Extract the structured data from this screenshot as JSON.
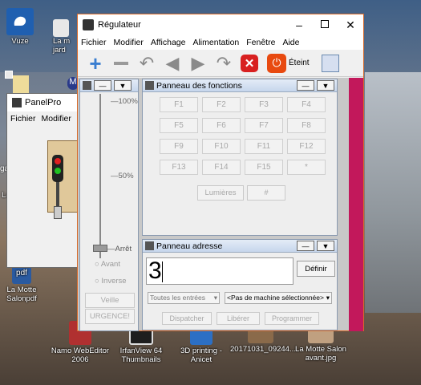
{
  "desktop": {
    "icons": {
      "vuze": "Vuze",
      "la_ma_jard": "La m\njard",
      "la_motte_salon_pdf": "La Motte\nSalonpdf",
      "namo": "Namo WebEditor\n2006",
      "irfanview": "IrfanView 64\nThumbnails",
      "printing": "3D printing -\nAnicet",
      "photo": "20171031_09244...",
      "la_motte_avant": "La Motte Salon\navant.jpg",
      "la": "La",
      "side_ga": "ga",
      "side_m": "M",
      "pdf_badge": "pdf"
    }
  },
  "panelpro": {
    "title": "PanelPro",
    "menu": [
      "Fichier",
      "Modifier"
    ]
  },
  "regulateur": {
    "title": "Régulateur",
    "menu": [
      "Fichier",
      "Modifier",
      "Affichage",
      "Alimentation",
      "Fenêtre",
      "Aide"
    ],
    "toolbar": {
      "power_label": "Éteint"
    },
    "throttle": {
      "title": "",
      "percent_100": "100%",
      "percent_50": "50%",
      "arret": "Arrêt",
      "avant": "Avant",
      "inverse": "Inverse",
      "veille": "Veille",
      "urgence": "URGENCE!",
      "speed_fraction": 0
    },
    "functions": {
      "title": "Panneau des fonctions",
      "buttons": [
        "F1",
        "F2",
        "F3",
        "F4",
        "F5",
        "F6",
        "F7",
        "F8",
        "F9",
        "F10",
        "F11",
        "F12",
        "F13",
        "F14",
        "F15",
        "*"
      ],
      "lumieres": "Lumières",
      "hash": "#"
    },
    "address": {
      "title": "Panneau adresse",
      "value": "3",
      "definir": "Définir",
      "filter_select": "Toutes les entrées",
      "machine_select": "<Pas de machine sélectionnée>",
      "dispatcher": "Dispatcher",
      "liberer": "Libérer",
      "programmer": "Programmer"
    }
  }
}
